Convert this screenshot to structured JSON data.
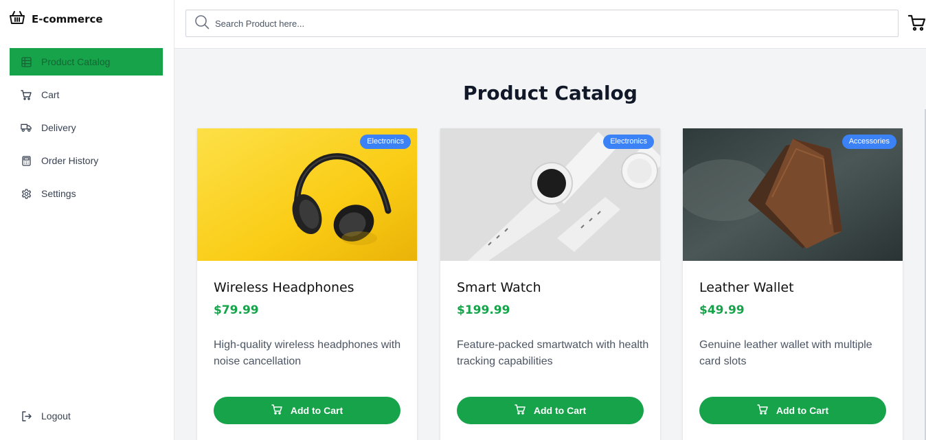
{
  "app": {
    "brand": "E-commerce",
    "brand_icon": "basket-icon"
  },
  "sidebar": {
    "items": [
      {
        "label": "Product Catalog",
        "icon": "table-icon",
        "active": true
      },
      {
        "label": "Cart",
        "icon": "cart-icon"
      },
      {
        "label": "Delivery",
        "icon": "truck-icon"
      },
      {
        "label": "Order History",
        "icon": "calculator-icon"
      },
      {
        "label": "Settings",
        "icon": "gear-icon"
      }
    ],
    "logout": {
      "label": "Logout",
      "icon": "logout-icon"
    }
  },
  "header": {
    "search_placeholder": "Search Product here...",
    "search_value": "",
    "cart_icon": "cart-icon"
  },
  "main": {
    "title": "Product Catalog",
    "products": [
      {
        "name": "Wireless Headphones",
        "price": "$79.99",
        "category": "Electronics",
        "description": "High-quality wireless headphones with noise cancellation",
        "button": "Add to Cart",
        "image": "headphones-image"
      },
      {
        "name": "Smart Watch",
        "price": "$199.99",
        "category": "Electronics",
        "description": "Feature-packed smartwatch with health tracking capabilities",
        "button": "Add to Cart",
        "image": "watch-image"
      },
      {
        "name": "Leather Wallet",
        "price": "$49.99",
        "category": "Accessories",
        "description": "Genuine leather wallet with multiple card slots",
        "button": "Add to Cart",
        "image": "wallet-image"
      }
    ]
  },
  "colors": {
    "accent": "#16a34a",
    "badge": "#3b82f6",
    "background": "#f3f4f6"
  }
}
